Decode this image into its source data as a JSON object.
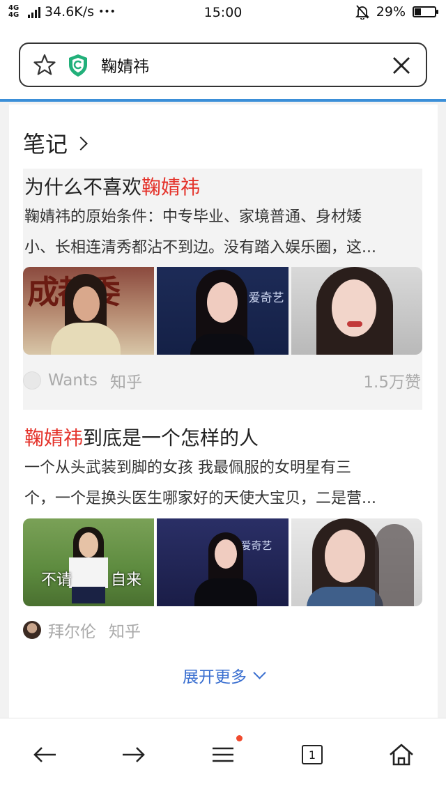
{
  "status_bar": {
    "network_type": "4G 4G",
    "speed": "34.6K/s",
    "dots": "•••",
    "time": "15:00",
    "battery": "29%",
    "battery_level": 0.29
  },
  "search": {
    "query": "鞠婧祎"
  },
  "section": {
    "title": "笔记"
  },
  "results": [
    {
      "title_prefix": "为什么不喜欢",
      "title_highlight": "鞠婧祎",
      "title_suffix": "",
      "desc_line1": "鞠婧祎的原始条件：中专毕业、家境普通、身材矮",
      "desc_line2": "小、长相连清秀都沾不到边。没有踏入娱乐圈，这...",
      "image_texts": [
        "成都委",
        "爱奇艺",
        ""
      ],
      "author": "Wants",
      "source": "知乎",
      "likes": "1.5万赞"
    },
    {
      "title_prefix": "",
      "title_highlight": "鞠婧祎",
      "title_suffix": "到底是一个怎样的人",
      "desc_line1": "一个从头武装到脚的女孩 我最佩服的女明星有三",
      "desc_line2": "个，一个是换头医生哪家好的天使大宝贝，二是营...",
      "image_texts": [
        "不请",
        "自来",
        "爱奇艺"
      ],
      "author": "拜尔伦",
      "source": "知乎",
      "likes": ""
    }
  ],
  "expand_more": "展开更多",
  "nav": {
    "tab_count": "1",
    "icons": [
      "back-arrow-icon",
      "forward-arrow-icon",
      "menu-icon",
      "tabs-icon",
      "home-icon"
    ]
  },
  "colors": {
    "highlight": "#e4322a",
    "link_blue": "#3a6fd0",
    "progress_blue": "#3b8fd8",
    "shield_green": "#22b07a",
    "notification_dot": "#f04a2e"
  }
}
